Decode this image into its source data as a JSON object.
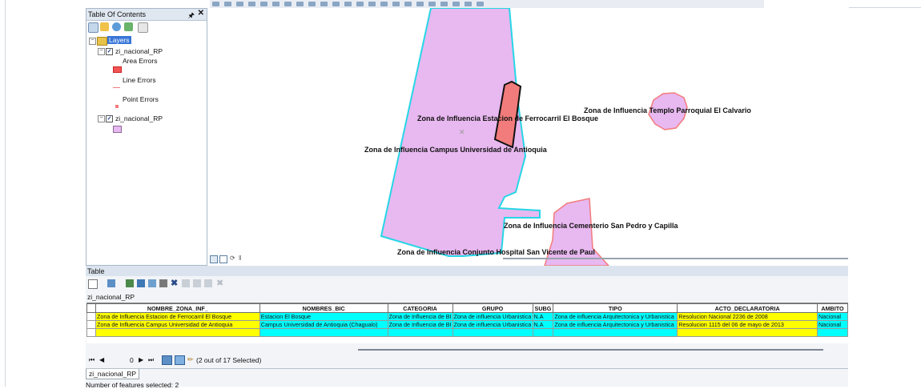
{
  "toc": {
    "title": "Table Of Contents",
    "root": "Layers",
    "layer1": "zi_nacional_RP",
    "legend": [
      "Area Errors",
      "Line Errors",
      "Point Errors"
    ],
    "layer2": "zi_nacional_RP"
  },
  "map": {
    "labels": [
      "Zona de Influencia Estacion de Ferrocarril El Bosque",
      "Zona de Influencia Templo Parroquial  El Calvario",
      "Zona de Influencia Campus Universidad de Antioquia",
      "Zona de Influencia Cementerio San Pedro y Capilla",
      "Zona de Influencia Conjunto Hospital San Vicente de Paul"
    ]
  },
  "table": {
    "title": "Table",
    "layer_name": "zi_nacional_RP",
    "columns": [
      "NOMBRE_ZONA_INF_",
      "NOMBRES_BIC",
      "CATEGORIA",
      "GRUPO",
      "SUBG",
      "TIPO",
      "ACTO_DECLARATORIA",
      "AMBITO"
    ],
    "rows": [
      [
        "Zona de Influencia Estacion de Ferrocarril El Bosque",
        "Estacion El Bosque",
        "Zona de Influencia de BI",
        "Zona de influencia Urbanistica",
        "N.A",
        "Zona de influencia Arquitectonica y Urbanistica",
        "Resolucion Nacional 2236 de 2008",
        "Nacional"
      ],
      [
        "Zona de Influencia Campus Universidad de Antioquia",
        "Campus Universidad de Antioquia (Chagualo)",
        "Zona de Influencia de BI",
        "Zona de influencia Urbanistica",
        "N.A",
        "Zona de influencia Arquitectonica y Urbanistica",
        "Resolucion 1115 del 06 de mayo de 2013",
        "Nacional"
      ]
    ],
    "nav_record": "0",
    "selection_text": "(2 out of 17 Selected)",
    "tab_label": "zi_nacional_RP",
    "status": "Number of features selected: 2"
  },
  "colors": {
    "polygon_fill": "#e8b8f0",
    "polygon_outline": "#26d6e6",
    "error_fill": "#f27b7b",
    "selection_cyan": "#00ffff",
    "selection_yellow": "#ffff00"
  },
  "icons": [
    "pin-icon",
    "close-icon",
    "list-by-drawing-order-icon",
    "list-by-source-icon",
    "list-by-visibility-icon",
    "list-by-selection-icon",
    "options-icon",
    "table-options-icon",
    "related-tables-icon",
    "select-by-attributes-icon",
    "switch-selection-icon",
    "clear-selection-icon",
    "zoom-to-selected-icon",
    "delete-selected-icon",
    "first-record-icon",
    "previous-record-icon",
    "next-record-icon",
    "last-record-icon",
    "show-all-records-icon",
    "show-selected-records-icon"
  ]
}
